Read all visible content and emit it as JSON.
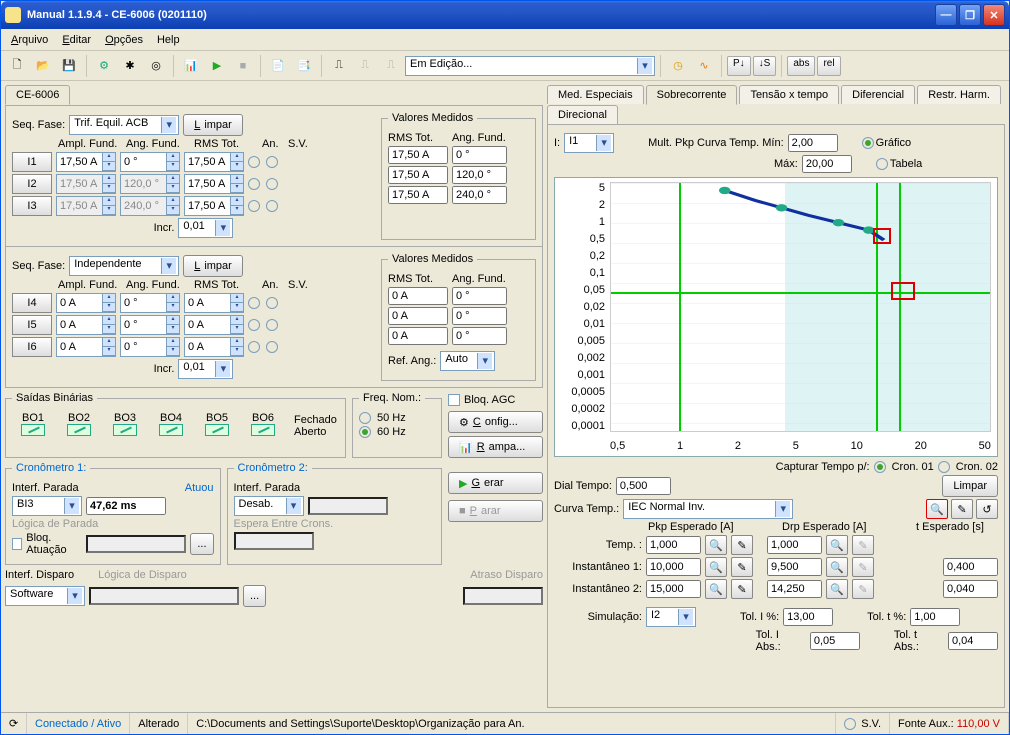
{
  "window": {
    "title": "Manual 1.1.9.4 - CE-6006 (0201110)"
  },
  "menu": {
    "arquivo": "Arquivo",
    "editar": "Editar",
    "opcoes": "Opções",
    "help": "Help"
  },
  "toolbar": {
    "mode_combo": "Em Edição..."
  },
  "left_tab": "CE-6006",
  "group1": {
    "seqfase_label": "Seq. Fase:",
    "seqfase": "Trif. Equil. ACB",
    "limpar": "Limpar",
    "hdr_amp": "Ampl. Fund.",
    "hdr_ang": "Ang. Fund.",
    "hdr_rms": "RMS Tot.",
    "hdr_an": "An.",
    "hdr_sv": "S.V.",
    "rows": [
      {
        "ch": "I1",
        "amp": "17,50 A",
        "ang": "0 °",
        "rms": "17,50 A"
      },
      {
        "ch": "I2",
        "amp": "17,50 A",
        "ang": "120,0 °",
        "rms": "17,50 A"
      },
      {
        "ch": "I3",
        "amp": "17,50 A",
        "ang": "240,0 °",
        "rms": "17,50 A"
      }
    ],
    "incr_label": "Incr.",
    "incr": "0,01"
  },
  "valores1": {
    "title": "Valores Medidos",
    "hdr_rms": "RMS Tot.",
    "hdr_ang": "Ang. Fund.",
    "rows": [
      {
        "rms": "17,50 A",
        "ang": "0 °"
      },
      {
        "rms": "17,50 A",
        "ang": "120,0 °"
      },
      {
        "rms": "17,50 A",
        "ang": "240,0 °"
      }
    ]
  },
  "group2": {
    "seqfase_label": "Seq. Fase:",
    "seqfase": "Independente",
    "limpar": "Limpar",
    "hdr_amp": "Ampl. Fund.",
    "hdr_ang": "Ang. Fund.",
    "hdr_rms": "RMS Tot.",
    "hdr_an": "An.",
    "hdr_sv": "S.V.",
    "rows": [
      {
        "ch": "I4",
        "amp": "0 A",
        "ang": "0 °",
        "rms": "0 A"
      },
      {
        "ch": "I5",
        "amp": "0 A",
        "ang": "0 °",
        "rms": "0 A"
      },
      {
        "ch": "I6",
        "amp": "0 A",
        "ang": "0 °",
        "rms": "0 A"
      }
    ],
    "incr_label": "Incr.",
    "incr": "0,01"
  },
  "valores2": {
    "title": "Valores Medidos",
    "hdr_rms": "RMS Tot.",
    "hdr_ang": "Ang. Fund.",
    "rows": [
      {
        "rms": "0 A",
        "ang": "0 °"
      },
      {
        "rms": "0 A",
        "ang": "0 °"
      },
      {
        "rms": "0 A",
        "ang": "0 °"
      }
    ],
    "refang_label": "Ref. Ang.:",
    "refang": "Auto"
  },
  "saidas": {
    "title": "Saídas Binárias",
    "chs": [
      "BO1",
      "BO2",
      "BO3",
      "BO4",
      "BO5",
      "BO6"
    ],
    "fechado": "Fechado",
    "aberto": "Aberto"
  },
  "freq": {
    "title": "Freq. Nom.:",
    "o50": "50 Hz",
    "o60": "60 Hz"
  },
  "bloqagc": "Bloq. AGC",
  "config": "Config...",
  "rampa": "Rampa...",
  "gerar": "Gerar",
  "parar": "Parar",
  "cron1": {
    "title": "Cronômetro 1:",
    "interf": "Interf. Parada",
    "atuou": "Atuou",
    "sel": "BI3",
    "val": "47,62 ms",
    "logica": "Lógica de Parada",
    "bloq": "Bloq. Atuação"
  },
  "cron2": {
    "title": "Cronômetro 2:",
    "interf": "Interf. Parada",
    "sel": "Desab.",
    "espera": "Espera Entre Crons."
  },
  "interf_disparo": {
    "label": "Interf. Disparo",
    "sel": "Software",
    "logica": "Lógica de Disparo",
    "atraso": "Atraso Disparo"
  },
  "tabs": {
    "med": "Med. Especiais",
    "sobre": "Sobrecorrente",
    "tensao": "Tensão x tempo",
    "dif": "Diferencial",
    "restr": "Restr. Harm.",
    "dir": "Direcional"
  },
  "right": {
    "I_label": "I:",
    "I": "I1",
    "mult_label": "Mult. Pkp Curva Temp. Mín:",
    "mult_min": "2,00",
    "max_label": "Máx:",
    "max": "20,00",
    "grafico": "Gráfico",
    "tabela": "Tabela"
  },
  "chart_data": {
    "type": "line",
    "xscale": "log",
    "yscale": "log",
    "xticks": [
      0.5,
      1,
      2,
      5,
      10,
      20,
      50
    ],
    "yticks": [
      5,
      2,
      1,
      0.5,
      0.2,
      0.1,
      0.05,
      0.02,
      0.01,
      0.005,
      0.002,
      0.001,
      0.0005,
      0.0002,
      0.0001
    ],
    "series": [
      {
        "name": "curve",
        "color": "#1030a0",
        "x": [
          2,
          3,
          4,
          5,
          7,
          10,
          13
        ],
        "y": [
          5,
          3.5,
          2.5,
          1.9,
          1.3,
          0.95,
          0.28
        ]
      }
    ],
    "markers": [
      {
        "x": 13,
        "y": 0.28,
        "box": "red"
      },
      {
        "x": 15,
        "y": 0.05,
        "box": "red"
      }
    ]
  },
  "capture": {
    "label": "Capturar Tempo p/:",
    "c1": "Cron. 01",
    "c2": "Cron. 02",
    "limpar": "Limpar"
  },
  "curva": {
    "dial_label": "Dial Tempo:",
    "dial": "0,500",
    "curva_label": "Curva Temp.:",
    "curva": "IEC Normal Inv.",
    "pkp_hdr": "Pkp Esperado [A]",
    "drp_hdr": "Drp Esperado [A]",
    "t_hdr": "t Esperado [s]",
    "temp_label": "Temp. :",
    "temp_pkp": "1,000",
    "temp_drp": "1,000",
    "inst1_label": "Instantâneo 1:",
    "inst1_pkp": "10,000",
    "inst1_drp": "9,500",
    "inst1_t": "0,400",
    "inst2_label": "Instantâneo 2:",
    "inst2_pkp": "15,000",
    "inst2_drp": "14,250",
    "inst2_t": "0,040",
    "sim_label": "Simulação:",
    "sim": "I2",
    "tolI_label": "Tol. I %:",
    "tolI": "13,00",
    "tolt_label": "Tol. t %:",
    "tolt": "1,00",
    "tolIa_label": "Tol. I Abs.:",
    "tolIa": "0,05",
    "tolta_label": "Tol. t Abs.:",
    "tolta": "0,04"
  },
  "status": {
    "conn": "Conectado / Ativo",
    "alt": "Alterado",
    "path": "C:\\Documents and Settings\\Suporte\\Desktop\\Organização para An.",
    "sv": "S.V.",
    "fonte_l": "Fonte Aux.:",
    "fonte_v": "110,00 V"
  }
}
